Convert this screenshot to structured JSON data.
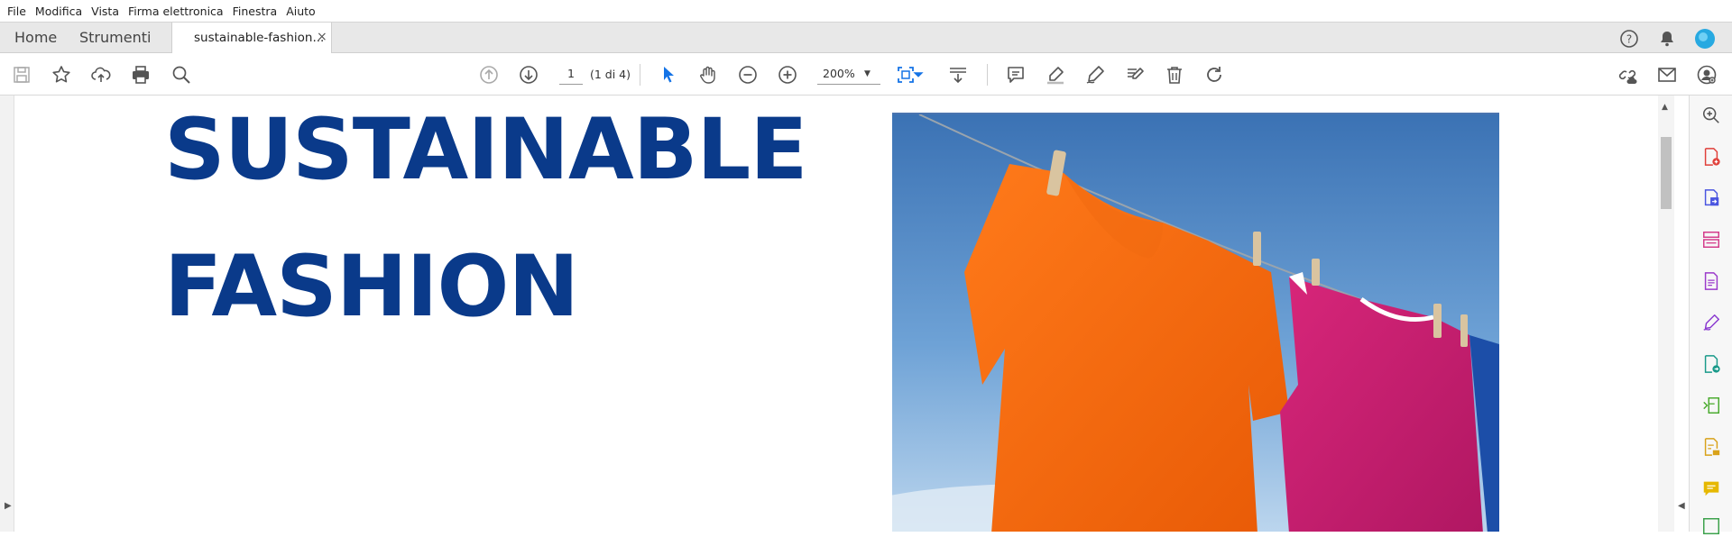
{
  "menu": [
    "File",
    "Modifica",
    "Vista",
    "Firma elettronica",
    "Finestra",
    "Aiuto"
  ],
  "tabs": {
    "home": "Home",
    "tools": "Strumenti",
    "document": "sustainable-fashion...",
    "close": "×"
  },
  "toolbar": {
    "page_current": "1",
    "page_of": "(1 di 4)",
    "zoom": "200%"
  },
  "document": {
    "title_line1": "SUSTAINABLE",
    "title_line2": "FASHION"
  },
  "colors": {
    "title": "#0a3a8a",
    "accent_blue": "#1473e6",
    "avatar": "#27a9e1"
  },
  "icons": {
    "tabbar_right": [
      "help-icon",
      "notification-bell-icon",
      "user-avatar-icon"
    ],
    "toolbar": [
      "save-icon",
      "bookmark-star-icon",
      "upload-cloud-icon",
      "print-icon",
      "search-zoom-icon",
      "previous-page-icon",
      "next-page-icon",
      "select-cursor-icon",
      "hand-pan-icon",
      "zoom-out-icon",
      "zoom-in-icon",
      "fit-page-icon",
      "scroll-mode-icon",
      "comment-icon",
      "highlight-pen-icon",
      "sign-icon",
      "edit-text-icon",
      "delete-icon",
      "rotate-icon",
      "share-link-icon",
      "email-icon",
      "account-icon"
    ],
    "right_panel": [
      "zoom-search-icon",
      "create-pdf-icon",
      "export-pdf-icon",
      "organize-pages-icon",
      "edit-pdf-icon",
      "fill-sign-icon",
      "send-for-signature-icon",
      "compress-icon",
      "protect-icon",
      "comment-tool-icon",
      "more-tools-icon"
    ]
  }
}
